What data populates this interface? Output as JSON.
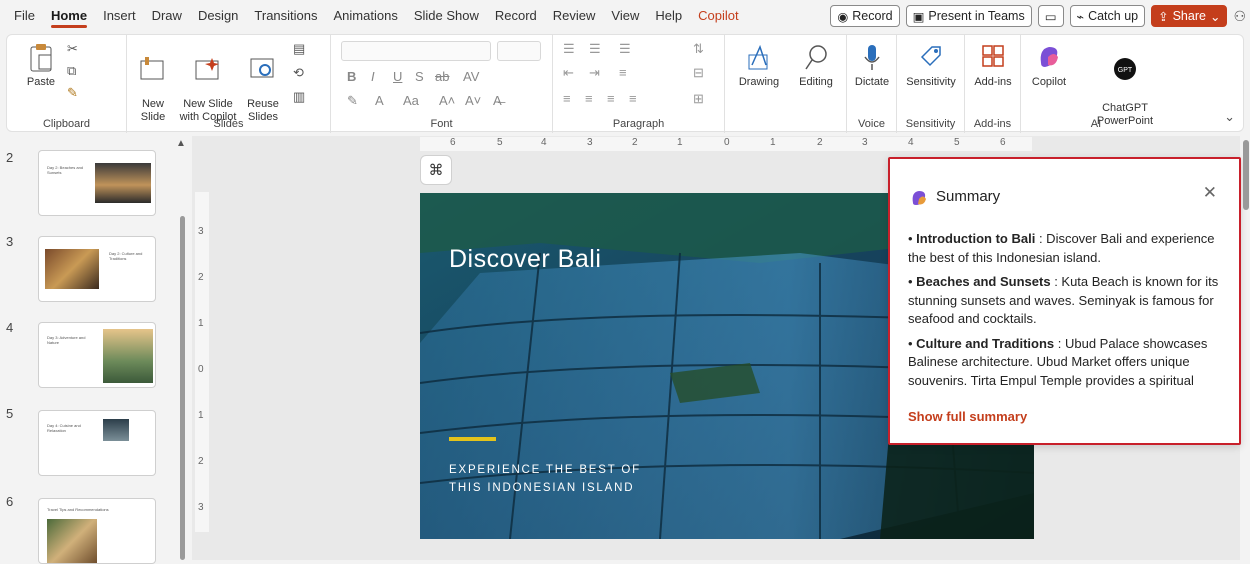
{
  "menu": {
    "tabs": [
      "File",
      "Home",
      "Insert",
      "Draw",
      "Design",
      "Transitions",
      "Animations",
      "Slide Show",
      "Record",
      "Review",
      "View",
      "Help",
      "Copilot"
    ],
    "record_btn": "Record",
    "present_btn": "Present in Teams",
    "catchup_btn": "Catch up",
    "share_btn": "Share"
  },
  "ribbon": {
    "paste": "Paste",
    "new_slide": "New\nSlide",
    "new_slide_copilot": "New Slide\nwith Copilot",
    "reuse_slides": "Reuse\nSlides",
    "drawing": "Drawing",
    "editing": "Editing",
    "dictate": "Dictate",
    "sensitivity": "Sensitivity",
    "addins": "Add-ins",
    "copilot": "Copilot",
    "chatgpt": "ChatGPT\nPowerPoint",
    "groups": {
      "clipboard": "Clipboard",
      "slides": "Slides",
      "font": "Font",
      "paragraph": "Paragraph",
      "voice": "Voice",
      "sensitivity": "Sensitivity",
      "addins": "Add-ins",
      "ai": "AI"
    }
  },
  "thumbnails": [
    {
      "num": "2",
      "text": "Day 2: Beaches and Sunsets"
    },
    {
      "num": "3",
      "text": "Day 2: Culture and Traditions"
    },
    {
      "num": "4",
      "text": "Day 3: Adventure and Nature"
    },
    {
      "num": "5",
      "text": "Day 4: Cuisine and Relaxation"
    },
    {
      "num": "6",
      "text": "Travel Tips and Recommendations"
    }
  ],
  "ruler": {
    "h_ticks": [
      "6",
      "5",
      "4",
      "3",
      "2",
      "1",
      "0",
      "1",
      "2",
      "3",
      "4",
      "5",
      "6"
    ],
    "v_ticks": [
      "3",
      "2",
      "1",
      "0",
      "1",
      "2",
      "3"
    ]
  },
  "slide": {
    "title": "Discover Bali",
    "subtitle": "EXPERIENCE THE BEST OF\nTHIS INDONESIAN ISLAND",
    "accent_color": "#e3c31b"
  },
  "summary": {
    "title": "Summary",
    "items": [
      {
        "heading": "Introduction to Bali",
        "text": ": Discover Bali and experience the best of this Indonesian island."
      },
      {
        "heading": "Beaches and Sunsets",
        "text": ": Kuta Beach is known for its stunning sunsets and waves. Seminyak is famous for seafood and cocktails."
      },
      {
        "heading": "Culture and Traditions",
        "text": ": Ubud Palace showcases Balinese architecture. Ubud Market offers unique souvenirs. Tirta Empul Temple provides a spiritual experience."
      }
    ],
    "link": "Show full summary",
    "border_color": "#c8202b"
  }
}
